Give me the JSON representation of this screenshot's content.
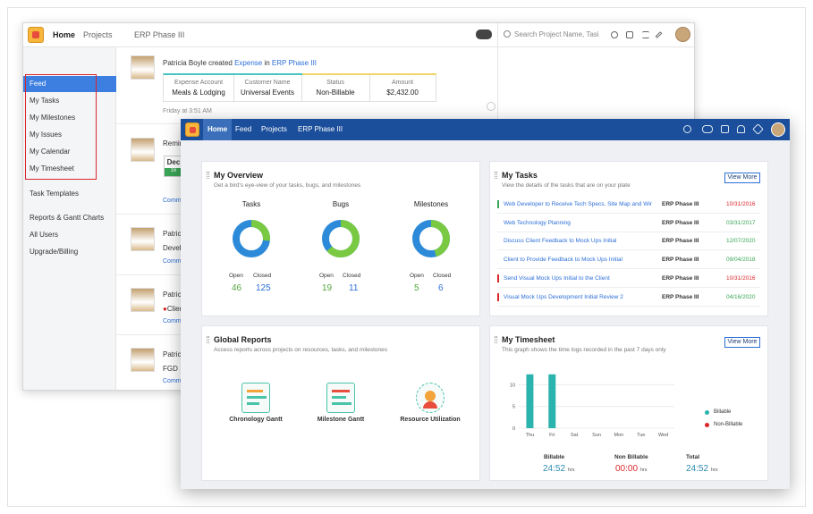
{
  "back_window": {
    "nav": {
      "home": "Home",
      "projects": "Projects",
      "project_name": "ERP Phase III"
    },
    "search_placeholder": "Search Project Name, Tasi",
    "sidebar": {
      "items": [
        "Feed",
        "My Tasks",
        "My Milestones",
        "My Issues",
        "My Calendar",
        "My Timesheet"
      ],
      "extra": [
        "Task Templates",
        "Reports & Gantt Charts",
        "All Users",
        "Upgrade/Billing"
      ]
    },
    "feed": [
      {
        "author": "Patricia Boyle",
        "action": "created",
        "object": "Expense",
        "joiner": "in",
        "project": "ERP Phase III",
        "expense": {
          "headers": [
            "Expense Account",
            "Customer Name",
            "Status",
            "Amount"
          ],
          "values": [
            "Meals & Lodging",
            "Universal Events",
            "Non-Billable",
            "$2,432.00"
          ]
        },
        "time": "Friday at 3:51 AM"
      },
      {
        "text": "Remin",
        "badge_top": "Dec",
        "badge_bottom": "16",
        "comment": "Comme"
      },
      {
        "author": "Patricia",
        "text": "Develo",
        "comment": "Comme"
      },
      {
        "author": "Patricia",
        "text": "Clien",
        "comment": "Comme"
      },
      {
        "author": "Patricia",
        "text": "FGD",
        "comment": "Comme"
      }
    ]
  },
  "front_window": {
    "nav": [
      "Home",
      "Feed",
      "Projects",
      "ERP Phase III"
    ],
    "overview": {
      "title": "My Overview",
      "subtitle": "Get a bird's eye-view of your tasks, bugs, and milestones",
      "groups": [
        {
          "label": "Tasks",
          "open_label": "Open",
          "closed_label": "Closed",
          "open": 46,
          "closed": 125
        },
        {
          "label": "Bugs",
          "open_label": "Open",
          "closed_label": "Closed",
          "open": 19,
          "closed": 11
        },
        {
          "label": "Milestones",
          "open_label": "Open",
          "closed_label": "Closed",
          "open": 5,
          "closed": 6
        }
      ]
    },
    "my_tasks": {
      "title": "My Tasks",
      "subtitle": "View the details of the tasks that are on your plate",
      "view_more": "View More",
      "rows": [
        {
          "name": "Web Developer to Receive Tech Specs, Site Map and Wir",
          "project": "ERP Phase III",
          "date": "10/31/2016",
          "color": "#d9262b",
          "bar": "#3aa657"
        },
        {
          "name": "Web Technology Planning",
          "project": "ERP Phase III",
          "date": "03/31/2017",
          "color": "#3aa657",
          "bar": ""
        },
        {
          "name": "Discuss Client Feedback to Mock Ups Initial",
          "project": "ERP Phase III",
          "date": "12/07/2020",
          "color": "#3aa657",
          "bar": ""
        },
        {
          "name": "Client to Provide Feedback to Mock Ups Initial",
          "project": "ERP Phase III",
          "date": "09/04/2018",
          "color": "#3aa657",
          "bar": ""
        },
        {
          "name": "Send Visual Mock Ups Initial to the Client",
          "project": "ERP Phase III",
          "date": "10/31/2016",
          "color": "#d9262b",
          "bar": "#d9262b"
        },
        {
          "name": "Visual Mock Ups Development Initial Review 2",
          "project": "ERP Phase III",
          "date": "04/16/2020",
          "color": "#3aa657",
          "bar": "#d9262b"
        }
      ]
    },
    "global_reports": {
      "title": "Global Reports",
      "subtitle": "Access reports across projects on resources, tasks, and milestones",
      "items": [
        "Chronology Gantt",
        "Milestone Gantt",
        "Resource Utilization"
      ]
    },
    "timesheet": {
      "title": "My Timesheet",
      "subtitle": "This graph shows the time logs recorded in the past 7 days only",
      "view_more": "View More",
      "legend": [
        "Billable",
        "Non-Billable"
      ],
      "totals": [
        {
          "label": "Billable",
          "value": "24:52",
          "unit": "hrs",
          "color": "#2d8bb0"
        },
        {
          "label": "Non Billable",
          "value": "00:00",
          "unit": "hrs",
          "color": "#d9262b"
        },
        {
          "label": "Total",
          "value": "24:52",
          "unit": "hrs",
          "color": "#2d8bb0"
        }
      ]
    },
    "chart_data": {
      "type": "bar",
      "categories": [
        "Thu",
        "Fri",
        "Sat",
        "Sun",
        "Mon",
        "Tue",
        "Wed"
      ],
      "series": [
        {
          "name": "Billable",
          "values": [
            12.4,
            12.4,
            0,
            0,
            0,
            0,
            0
          ],
          "color": "#2bb3ad"
        },
        {
          "name": "Non-Billable",
          "values": [
            0,
            0,
            0,
            0,
            0,
            0,
            0
          ],
          "color": "#d9262b"
        }
      ],
      "yticks": [
        0,
        5,
        10
      ],
      "ylim": [
        0,
        14
      ],
      "xlabel": "",
      "ylabel": ""
    }
  }
}
